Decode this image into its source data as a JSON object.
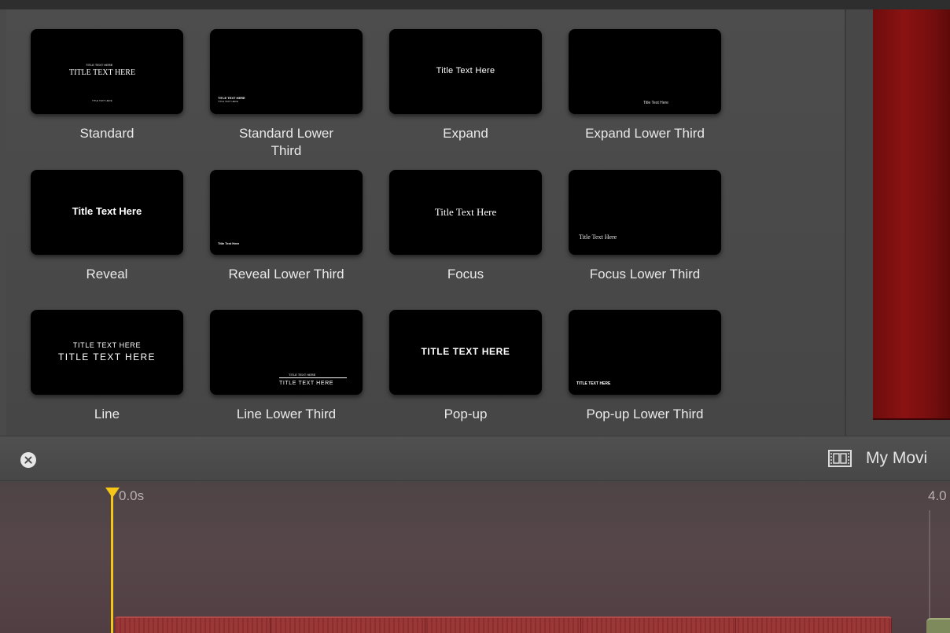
{
  "titles": [
    {
      "label": "Standard",
      "lines": [
        "TITLE TEXT HERE",
        "TITLE TEXT HERE",
        "TITLE TEXT HERE"
      ]
    },
    {
      "label": "Standard Lower Third",
      "lines": [
        "TITLE TEXT HERE",
        "TITLE TEXT HERE"
      ]
    },
    {
      "label": "Expand",
      "lines": [
        "Title Text Here"
      ]
    },
    {
      "label": "Expand Lower Third",
      "lines": [
        "Title Text Here"
      ]
    },
    {
      "label": "Reveal",
      "lines": [
        "Title Text Here"
      ]
    },
    {
      "label": "Reveal Lower Third",
      "lines": [
        "Title Text Here"
      ]
    },
    {
      "label": "Focus",
      "lines": [
        "Title Text Here"
      ]
    },
    {
      "label": "Focus Lower Third",
      "lines": [
        "Title Text Here"
      ]
    },
    {
      "label": "Line",
      "lines": [
        "TITLE TEXT HERE",
        "TITLE TEXT HERE"
      ]
    },
    {
      "label": "Line Lower Third",
      "lines": [
        "TITLE TEXT HERE",
        "TITLE TEXT HERE"
      ]
    },
    {
      "label": "Pop-up",
      "lines": [
        "TITLE TEXT HERE"
      ]
    },
    {
      "label": "Pop-up Lower Third",
      "lines": [
        "TITLE TEXT HERE"
      ]
    }
  ],
  "toolbar": {
    "close_icon": "close-circle-icon",
    "movie_icon": "film-strip-icon",
    "movie_title": "My Movi"
  },
  "timeline": {
    "start_time": "0.0s",
    "end_time": "4.0",
    "playhead_color": "#f5c518",
    "clip_color": "#8d2e2e"
  }
}
